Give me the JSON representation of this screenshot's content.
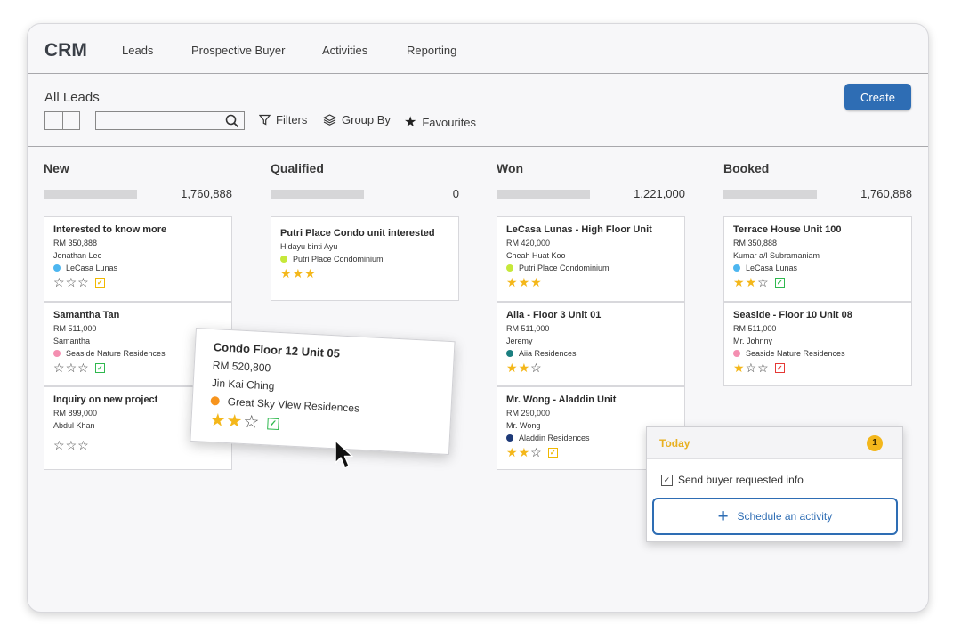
{
  "app": {
    "brand": "CRM"
  },
  "nav": [
    "Leads",
    "Prospective Buyer",
    "Activities",
    "Reporting"
  ],
  "subbar": {
    "title": "All Leads",
    "search_placeholder": "",
    "filters": "Filters",
    "group_by": "Group By",
    "favourites": "Favourites",
    "create": "Create"
  },
  "columns": [
    {
      "title": "New",
      "total": "1,760,888"
    },
    {
      "title": "Qualified",
      "total": "0"
    },
    {
      "title": "Won",
      "total": "1,221,000"
    },
    {
      "title": "Booked",
      "total": "1,760,888"
    }
  ],
  "cards": {
    "new": [
      {
        "title": "Interested to know more",
        "price": "RM 350,888",
        "contact": "Jonathan Lee",
        "property": "LeCasa Lunas",
        "dot": "#4db6f0",
        "rating": 0,
        "check": "yellow"
      },
      {
        "title": "Samantha Tan",
        "price": "RM 511,000",
        "contact": "Samantha",
        "property": "Seaside Nature Residences",
        "dot": "#f48fb1",
        "rating": 0,
        "check": "green"
      },
      {
        "title": "Inquiry on new project",
        "price": "RM 899,000",
        "contact": "Abdul Khan",
        "rating": 0
      }
    ],
    "qualified": [
      {
        "title": "Putri Place Condo unit interested",
        "contact": "Hidayu binti Ayu",
        "property": "Putri Place Condominium",
        "dot": "#c6e83a",
        "rating": 3
      }
    ],
    "won": [
      {
        "title": "LeCasa Lunas - High Floor Unit",
        "price": "RM 420,000",
        "contact": "Cheah Huat Koo",
        "property": "Putri Place Condominium",
        "dot": "#c6e83a",
        "rating": 3
      },
      {
        "title": "Aiia - Floor 3 Unit 01",
        "price": "RM 511,000",
        "contact": "Jeremy",
        "property": "Aiia Residences",
        "dot": "#1b7f80",
        "rating": 2
      },
      {
        "title": "Mr. Wong - Aladdin Unit",
        "price": "RM 290,000",
        "contact": "Mr. Wong",
        "property": "Aladdin Residences",
        "dot": "#1e3a78",
        "rating": 2,
        "check": "yellow"
      }
    ],
    "booked": [
      {
        "title": "Terrace House Unit 100",
        "price": "RM 350,888",
        "contact": "Kumar a/l Subramaniam",
        "property": "LeCasa Lunas",
        "dot": "#4db6f0",
        "rating": 2,
        "check": "green"
      },
      {
        "title": "Seaside - Floor 10 Unit 08",
        "price": "RM 511,000",
        "contact": "Mr. Johnny",
        "property": "Seaside Nature Residences",
        "dot": "#f48fb1",
        "rating": 1,
        "check": "red"
      }
    ]
  },
  "dragging_card": {
    "title": "Condo Floor 12 Unit 05",
    "price": "RM 520,800",
    "contact": "Jin Kai Ching",
    "property": "Great Sky View Residences",
    "dot": "#f7941d",
    "rating": 2,
    "check": "green"
  },
  "today": {
    "title": "Today",
    "count": "1",
    "task": "Send buyer requested info",
    "schedule": "Schedule an activity"
  },
  "icons": {
    "check_mark": "✓",
    "star_on": "★",
    "star_off": "☆",
    "plus": "+"
  }
}
